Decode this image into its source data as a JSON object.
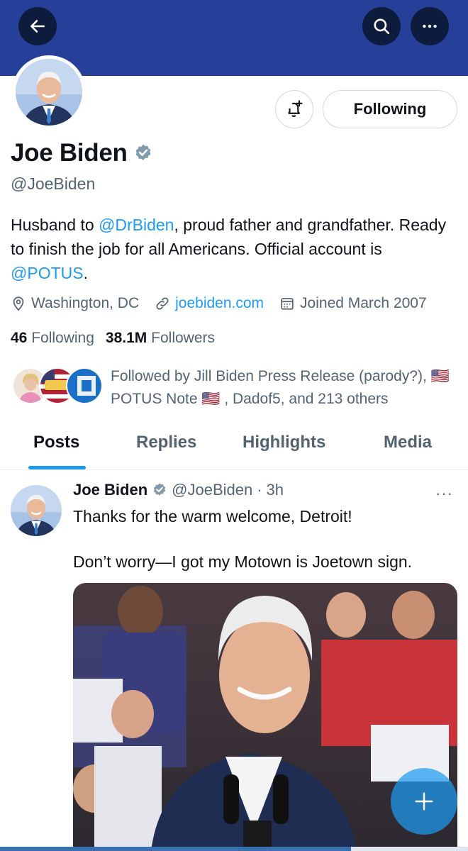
{
  "header": {
    "back_icon": "arrow-left-icon",
    "search_icon": "search-icon",
    "more_icon": "more-horizontal-icon",
    "banner_color": "#26409a"
  },
  "profile": {
    "name": "Joe Biden",
    "handle": "@JoeBiden",
    "verified_icon": "verified-badge-icon",
    "following_button": "Following",
    "notify_icon": "bell-plus-icon",
    "bio": {
      "part1": "Husband to ",
      "mention1": "@DrBiden",
      "part2": ", proud father and grandfather. Ready to finish the job for all Americans. Official account is ",
      "mention2": "@POTUS",
      "part3": "."
    },
    "location": "Washington, DC",
    "website": "joebiden.com",
    "joined": "Joined March 2007",
    "following_count": "46",
    "following_label": "Following",
    "followers_count": "38.1M",
    "followers_label": "Followers",
    "followed_by": "Followed by Jill Biden Press Release (parody?), 🇺🇸 POTUS Note 🇺🇸 , Dadof5, and 213 others"
  },
  "tabs": [
    {
      "label": "Posts",
      "active": true
    },
    {
      "label": "Replies",
      "active": false
    },
    {
      "label": "Highlights",
      "active": false
    },
    {
      "label": "Media",
      "active": false
    }
  ],
  "post": {
    "author": "Joe Biden",
    "handle": "@JoeBiden",
    "separator": "·",
    "time": "3h",
    "more": "···",
    "text_line1": "Thanks for the warm welcome, Detroit!",
    "text_line2": "Don’t worry—I got my Motown is Joetown sign."
  },
  "fab_icon": "plus-icon",
  "accent_color": "#1d9bf0"
}
